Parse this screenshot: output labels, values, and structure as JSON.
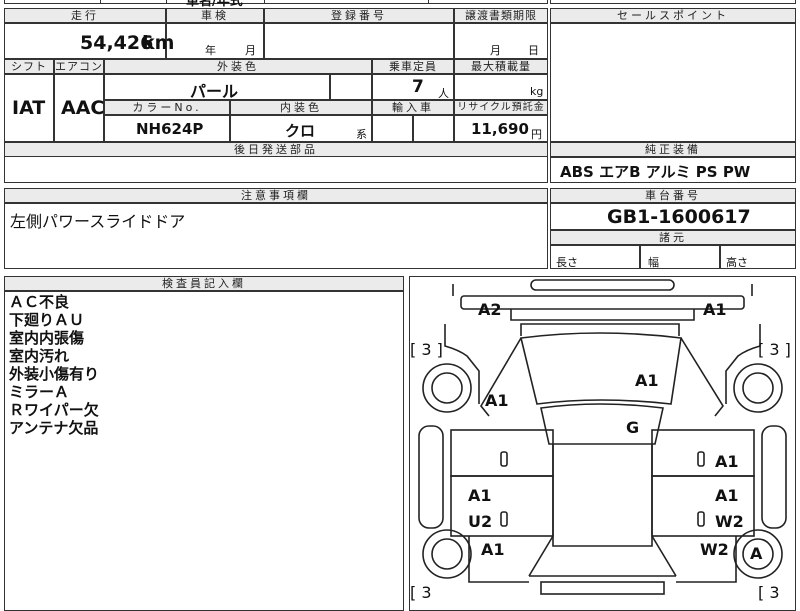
{
  "top_partial": {
    "model_label": "車名/年式"
  },
  "grid": {
    "headers": {
      "mileage": "走行",
      "inspection": "車検",
      "registration": "登録番号",
      "transfer_deadline": "譲渡書類期限",
      "shift": "シフト",
      "aircon": "エアコン",
      "exterior_color": "外装色",
      "capacity": "乗車定員",
      "max_load": "最大積載量",
      "color_no": "カラーNo.",
      "interior_color": "内装色",
      "import": "輸入車",
      "recycle": "リサイクル預託金",
      "later_parts": "後日発送部品"
    },
    "mileage_value": "54,426",
    "mileage_unit": "km",
    "year_unit": "年",
    "month_unit": "月",
    "deadline_month": "月",
    "deadline_day": "日",
    "shift_value": "IAT",
    "aircon_value": "AAC",
    "exterior_value": "パール",
    "capacity_value": "7",
    "capacity_unit": "人",
    "load_unit": "kg",
    "color_no_value": "NH624P",
    "interior_value": "クロ",
    "interior_suffix": "系",
    "recycle_value": "11,690",
    "recycle_unit": "円"
  },
  "sales_point": {
    "header": "セールスポイント"
  },
  "standard_equipment": {
    "header": "純正装備",
    "value": "ABS エアB アルミ PS PW"
  },
  "caution": {
    "header": "注意事項欄",
    "value": "左側パワースライドドア"
  },
  "chassis": {
    "header": "車台番号",
    "value": "GB1-1600617"
  },
  "dimensions": {
    "header": "諸元",
    "length": "長さ",
    "width": "幅",
    "height": "高さ"
  },
  "inspector": {
    "header": "検査員記入欄",
    "notes": [
      "ＡＣ不良",
      "下廻りＡＵ",
      "室内内張傷",
      "室内汚れ",
      "外装小傷有り",
      "ミラーＡ",
      "Ｒワイパー欠",
      "アンテナ欠品"
    ]
  },
  "diagram": {
    "marks": {
      "front_left": "A2",
      "front_right": "A1",
      "roof": "A1",
      "left_front_fender": "A1",
      "glass": "G",
      "right_front_door": "A1",
      "left_rear_door_a": "A1",
      "left_rear_door_u": "U2",
      "right_rear_door_a": "A1",
      "right_rear_door_w": "W2",
      "left_rear_fender": "A1",
      "right_rear_fender": "W2",
      "right_rear_wheel": "A"
    },
    "counts": {
      "left_top": "[ 3 ]",
      "right_top": "[ 3 ]",
      "left_bottom": "[ 3",
      "right_bottom": "[ 3"
    }
  }
}
